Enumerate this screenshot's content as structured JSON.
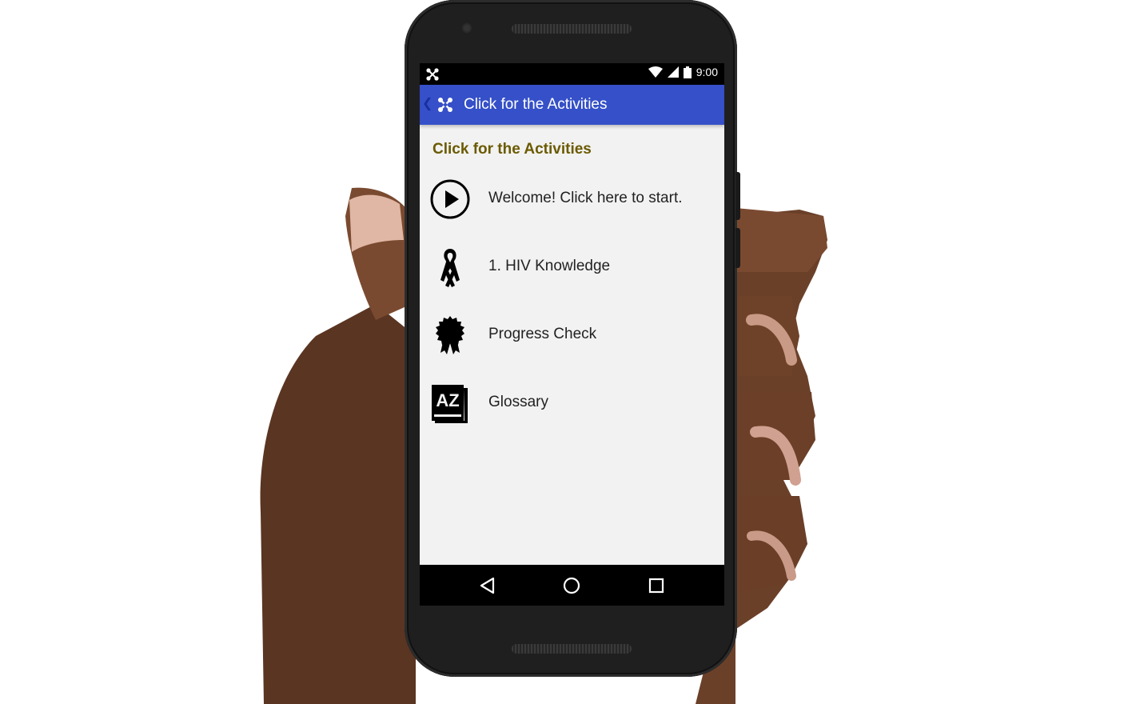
{
  "status_bar": {
    "time": "9:00"
  },
  "app_bar": {
    "title": "Click for the Activities"
  },
  "content": {
    "section_title": "Click for the Activities",
    "items": [
      {
        "label": "Welcome! Click here to start.",
        "icon": "play-circle-icon"
      },
      {
        "label": "1.  HIV Knowledge",
        "icon": "awareness-ribbon-icon"
      },
      {
        "label": "Progress Check",
        "icon": "rosette-badge-icon"
      },
      {
        "label": "Glossary",
        "icon": "az-book-icon"
      }
    ]
  },
  "nav_bar": {
    "icons": [
      "back-triangle-icon",
      "home-circle-icon",
      "recents-square-icon"
    ]
  },
  "colors": {
    "app_bar": "#3550c8",
    "section_title": "#6b5a00",
    "screen_bg": "#f2f2f2"
  }
}
